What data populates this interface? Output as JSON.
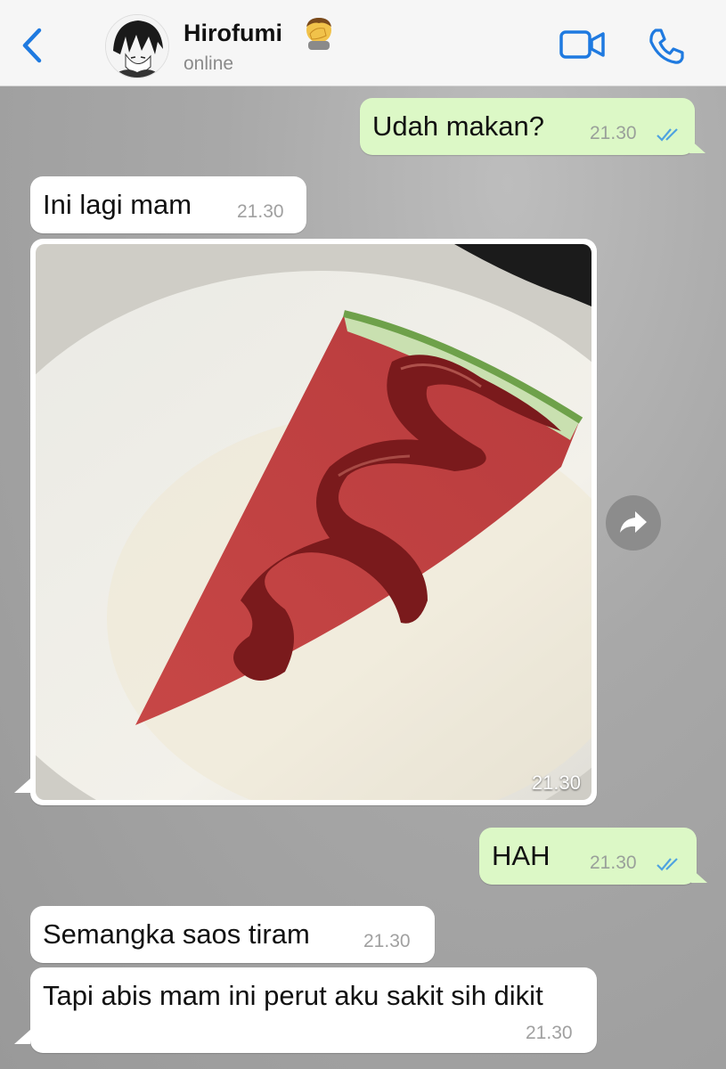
{
  "header": {
    "contact_name": "Hirofumi",
    "status": "online",
    "icons": [
      "back-chevron-icon",
      "avatar",
      "face-palm-emoji",
      "video-call-icon",
      "phone-call-icon"
    ],
    "accent_color": "#1f7ae0"
  },
  "messages": [
    {
      "direction": "outgoing",
      "text": "Udah makan?",
      "time": "21.30",
      "read": true
    },
    {
      "direction": "incoming",
      "text": "Ini lagi mam",
      "time": "21.30"
    },
    {
      "direction": "incoming",
      "type": "photo",
      "caption": "",
      "time": "21.30",
      "subject": "watermelon slice with sauce"
    },
    {
      "direction": "outgoing",
      "text": "HAH",
      "time": "21.30",
      "read": true
    },
    {
      "direction": "incoming",
      "text": "Semangka saos tiram",
      "time": "21.30"
    },
    {
      "direction": "incoming",
      "text": "Tapi abis mam ini perut aku sakit sih dikit",
      "time": "21.30"
    }
  ],
  "colors": {
    "outgoing_bubble": "#dcf8c6",
    "incoming_bubble": "#ffffff",
    "read_ticks": "#4fa3e0"
  }
}
